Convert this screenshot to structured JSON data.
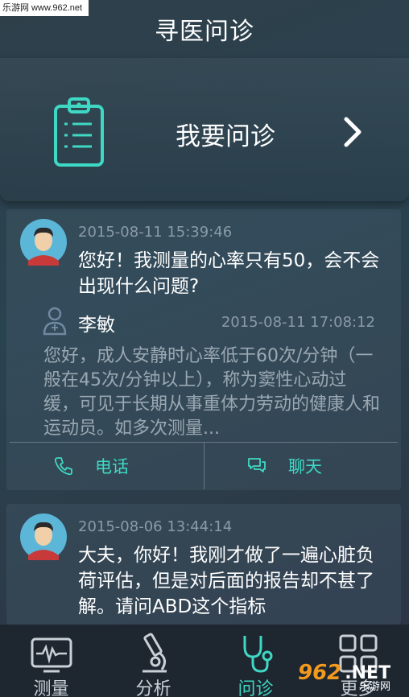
{
  "watermark": "乐游网 www.962.net",
  "header": {
    "title": "寻医问诊"
  },
  "consult": {
    "label": "我要问诊"
  },
  "posts": [
    {
      "time": "2015-08-11 15:39:46",
      "question": "您好！我测量的心率只有50，会不会出现什么问题?",
      "reply": {
        "doctor": "李敏",
        "time": "2015-08-11 17:08:12",
        "text": "您好，成人安静时心率低于60次/分钟（一般在45次/分钟以上），称为窦性心动过缓，可见于长期从事重体力劳动的健康人和运动员。如多次测量..."
      },
      "actions": {
        "phone": "电话",
        "chat": "聊天"
      }
    },
    {
      "time": "2015-08-06 13:44:14",
      "question": "大夫，你好！我刚才做了一遍心脏负荷评估，但是对后面的报告却不甚了解。请问ABD这个指标"
    }
  ],
  "tabs": [
    {
      "label": "测量",
      "icon": "ecg-monitor-icon"
    },
    {
      "label": "分析",
      "icon": "microscope-icon"
    },
    {
      "label": "问诊",
      "icon": "stethoscope-icon",
      "active": true
    },
    {
      "label": "更多",
      "icon": "grid-icon"
    }
  ],
  "brand": {
    "num": "962",
    "net": ".NET",
    "sub": "乐游网"
  },
  "colors": {
    "accent": "#3fd8c4",
    "muted": "#8a9aa8"
  }
}
